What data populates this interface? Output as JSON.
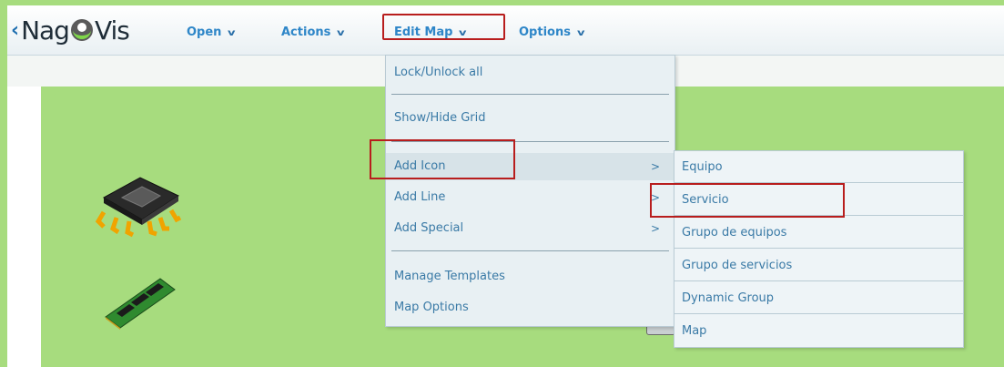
{
  "app": {
    "back_glyph": "‹",
    "logo_left": "Nag",
    "logo_right": "Vis"
  },
  "menubar": {
    "items": [
      {
        "label": "Open",
        "chevron": "v"
      },
      {
        "label": "Actions",
        "chevron": "v"
      },
      {
        "label": "Edit Map",
        "chevron": "v"
      },
      {
        "label": "Options",
        "chevron": "v"
      }
    ]
  },
  "edit_menu": {
    "items": [
      {
        "label": "Lock/Unlock all"
      },
      {
        "label": "Show/Hide Grid"
      },
      {
        "label": "Add Icon",
        "arrow": ">"
      },
      {
        "label": "Add Line",
        "arrow": ">"
      },
      {
        "label": "Add Special",
        "arrow": ">"
      },
      {
        "label": "Manage Templates"
      },
      {
        "label": "Map Options"
      }
    ]
  },
  "add_icon_submenu": {
    "items": [
      {
        "label": "Equipo"
      },
      {
        "label": "Servicio"
      },
      {
        "label": "Grupo de equipos"
      },
      {
        "label": "Grupo de servicios"
      },
      {
        "label": "Dynamic Group"
      },
      {
        "label": "Map"
      }
    ]
  },
  "colors": {
    "map_background": "#a7dc7e",
    "menu_text": "#2e86c8",
    "highlight_border": "#b81d1d"
  },
  "map_icons": [
    "cpu-chip-icon",
    "ram-module-icon"
  ]
}
